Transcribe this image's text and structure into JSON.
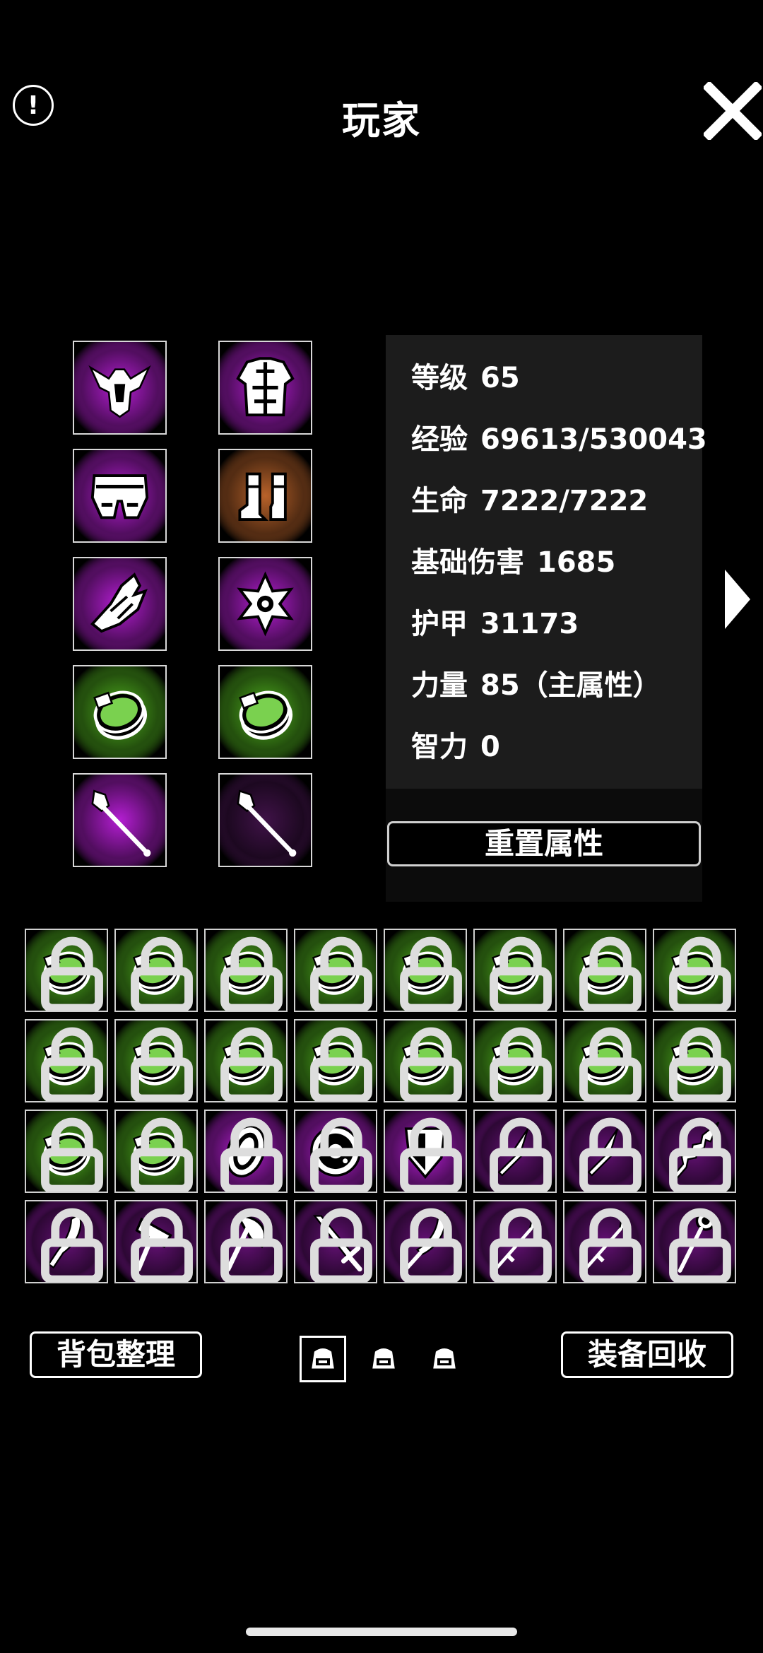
{
  "header": {
    "title": "玩家",
    "info_icon": "info-icon",
    "close_icon": "close-icon"
  },
  "equipment": [
    {
      "name": "helmet",
      "icon": "horned-helmet-icon",
      "glow": "purple"
    },
    {
      "name": "chest",
      "icon": "chest-armor-icon",
      "glow": "purple"
    },
    {
      "name": "legs",
      "icon": "leg-armor-icon",
      "glow": "purple"
    },
    {
      "name": "boots",
      "icon": "boots-icon",
      "glow": "orange"
    },
    {
      "name": "gloves",
      "icon": "gauntlet-icon",
      "glow": "purple"
    },
    {
      "name": "amulet",
      "icon": "amulet-icon",
      "glow": "purple"
    },
    {
      "name": "ring1",
      "icon": "ring-icon",
      "glow": "green"
    },
    {
      "name": "ring2",
      "icon": "ring-icon",
      "glow": "green"
    },
    {
      "name": "main-hand",
      "icon": "staff-icon",
      "glow": "purple"
    },
    {
      "name": "off-hand",
      "icon": "staff-icon",
      "glow": "dim"
    }
  ],
  "stats": [
    {
      "label": "等级",
      "value": "65"
    },
    {
      "label": "经验",
      "value": "69613/530043"
    },
    {
      "label": "生命",
      "value": "7222/7222"
    },
    {
      "label": "基础伤害",
      "value": "1685"
    },
    {
      "label": "护甲",
      "value": "31173"
    },
    {
      "label": "力量",
      "value": "85（主属性）"
    },
    {
      "label": "智力",
      "value": "0"
    }
  ],
  "reset_label": "重置属性",
  "inventory": [
    "ring",
    "ring",
    "ring",
    "ring",
    "ring",
    "ring",
    "ring",
    "ring",
    "ring",
    "ring",
    "ring",
    "ring",
    "ring",
    "ring",
    "ring",
    "ring",
    "ring",
    "ring",
    "round-shield",
    "buckler",
    "kite-shield",
    "dagger",
    "dagger",
    "serrated-sword",
    "curved-blade",
    "hammer",
    "axe",
    "sword",
    "scimitar",
    "spear",
    "spear",
    "mace-staff"
  ],
  "inventory_lock_icon": "lock-icon",
  "bottom": {
    "sort_label": "背包整理",
    "recycle_label": "装备回收",
    "bag_tabs": [
      "bag-1",
      "bag-2",
      "bag-3"
    ],
    "active_tab": 0
  },
  "colors": {
    "purple_glow": "#b41ed2",
    "green_glow": "#4fb01e",
    "orange_glow": "#b8622a",
    "panel": "#1c1c1c"
  }
}
